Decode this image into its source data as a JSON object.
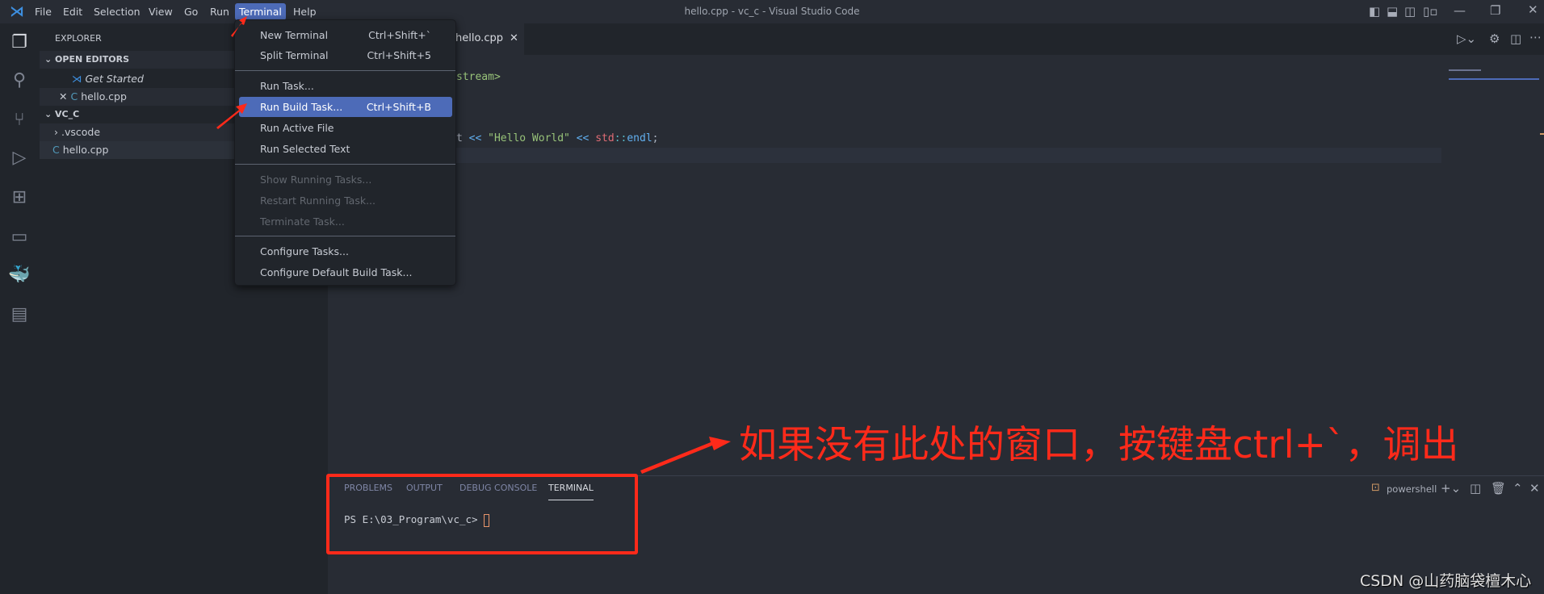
{
  "window": {
    "title": "hello.cpp - vc_c - Visual Studio Code"
  },
  "menubar": [
    "File",
    "Edit",
    "Selection",
    "View",
    "Go",
    "Run",
    "Terminal",
    "Help"
  ],
  "active_menu": "Terminal",
  "terminal_menu": [
    {
      "label": "New Terminal",
      "shortcut": "Ctrl+Shift+`"
    },
    {
      "label": "Split Terminal",
      "shortcut": "Ctrl+Shift+5"
    },
    {
      "label": "Run Task..."
    },
    {
      "label": "Run Build Task...",
      "shortcut": "Ctrl+Shift+B",
      "highlighted": true
    },
    {
      "label": "Run Active File"
    },
    {
      "label": "Run Selected Text"
    },
    {
      "label": "Show Running Tasks...",
      "disabled": true
    },
    {
      "label": "Restart Running Task...",
      "disabled": true
    },
    {
      "label": "Terminate Task...",
      "disabled": true
    },
    {
      "label": "Configure Tasks..."
    },
    {
      "label": "Configure Default Build Task..."
    }
  ],
  "sidebar": {
    "title": "EXPLORER",
    "open_editors": "OPEN EDITORS",
    "open_items": [
      "Get Started",
      "hello.cpp"
    ],
    "folder": "VC_C",
    "files": [
      ".vscode",
      "hello.cpp"
    ]
  },
  "editor": {
    "tab": "hello.cpp",
    "visible_code": [
      "stream>",
      "t << \"Hello World\" << std::endl;"
    ]
  },
  "panel": {
    "tabs": [
      "PROBLEMS",
      "OUTPUT",
      "DEBUG CONSOLE",
      "TERMINAL"
    ],
    "active_tab": "TERMINAL",
    "shell": "powershell",
    "prompt": "PS E:\\03_Program\\vc_c>"
  },
  "annotation": "如果没有此处的窗口，按键盘ctrl+`，调出",
  "watermark": "CSDN @山药脑袋檀木心",
  "colors": {
    "accent": "#4d6bb8",
    "annotation": "#ff2a1a"
  }
}
